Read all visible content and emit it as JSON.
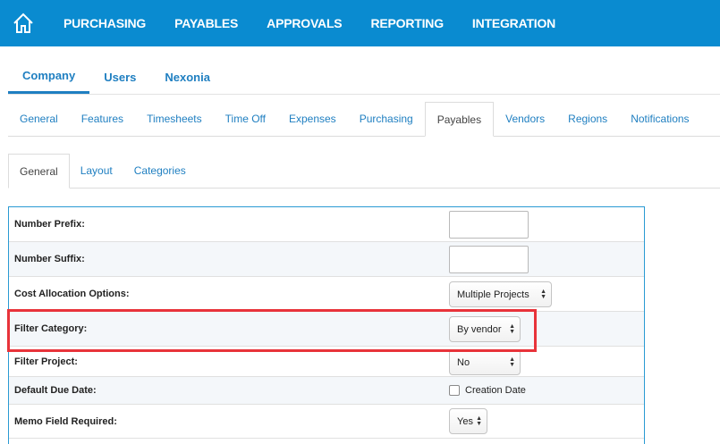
{
  "topnav": {
    "items": [
      "PURCHASING",
      "PAYABLES",
      "APPROVALS",
      "REPORTING",
      "INTEGRATION"
    ]
  },
  "tabs_level1": {
    "items": [
      "Company",
      "Users",
      "Nexonia"
    ],
    "active": "Company"
  },
  "tabs_level2": {
    "items": [
      "General",
      "Features",
      "Timesheets",
      "Time Off",
      "Expenses",
      "Purchasing",
      "Payables",
      "Vendors",
      "Regions",
      "Notifications"
    ],
    "active": "Payables"
  },
  "tabs_level3": {
    "items": [
      "General",
      "Layout",
      "Categories"
    ],
    "active": "General"
  },
  "settings": {
    "number_prefix": {
      "label": "Number Prefix:",
      "value": ""
    },
    "number_suffix": {
      "label": "Number Suffix:",
      "value": ""
    },
    "cost_allocation": {
      "label": "Cost Allocation Options:",
      "value": "Multiple Projects"
    },
    "filter_category": {
      "label": "Filter Category:",
      "value": "By vendor"
    },
    "filter_project": {
      "label": "Filter Project:",
      "value": "No"
    },
    "default_due_date": {
      "label": "Default Due Date:",
      "checkbox_label": "Creation Date",
      "checked": false
    },
    "memo_required": {
      "label": "Memo Field Required:",
      "value": "Yes"
    }
  },
  "colors": {
    "nav_bg": "#0a8bd0",
    "tab_link": "#1f7fc1",
    "highlight": "#e8333a",
    "table_border": "#2a9ad3"
  },
  "icons": {
    "home": "home-icon",
    "select_arrows": "updown-arrows-icon"
  }
}
